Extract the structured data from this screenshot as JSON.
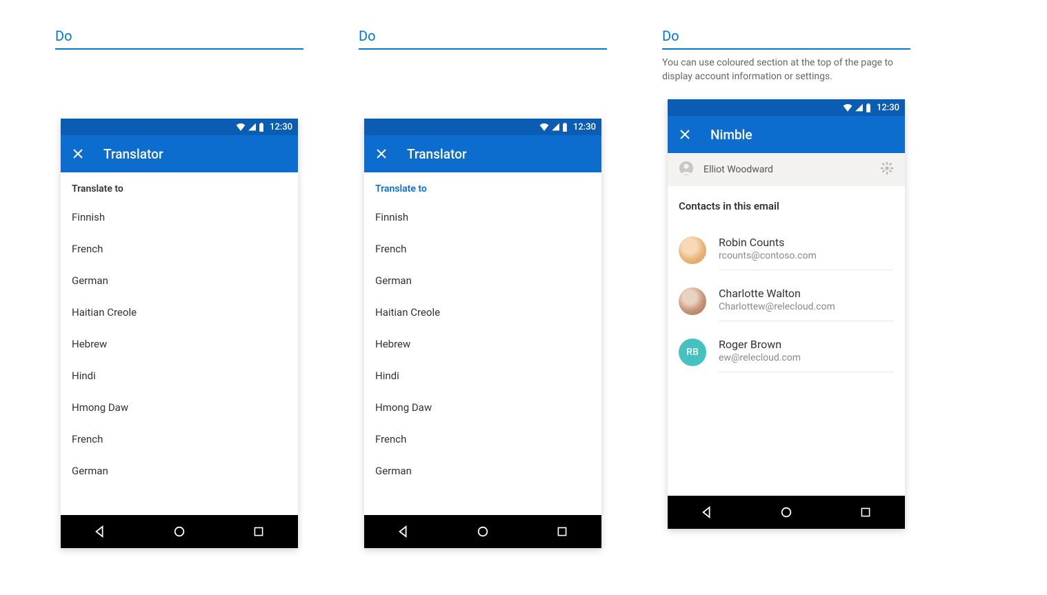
{
  "labels": {
    "do": "Do"
  },
  "captions": {
    "p1": "",
    "p2": "",
    "p3": "You can use coloured section at the top of the page to display account information or settings."
  },
  "status": {
    "time": "12:30"
  },
  "phone1": {
    "title": "Translator",
    "section": "Translate to",
    "items": [
      "Finnish",
      "French",
      "German",
      "Haitian Creole",
      "Hebrew",
      "Hindi",
      "Hmong Daw",
      "French",
      "German"
    ]
  },
  "phone2": {
    "title": "Translator",
    "section": "Translate to",
    "items": [
      "Finnish",
      "French",
      "German",
      "Haitian Creole",
      "Hebrew",
      "Hindi",
      "Hmong Daw",
      "French",
      "German"
    ]
  },
  "phone3": {
    "title": "Nimble",
    "account_name": "Elliot Woodward",
    "contacts_header": "Contacts in this email",
    "contacts": [
      {
        "name": "Robin Counts",
        "email": "rcounts@contoso.com",
        "initials": ""
      },
      {
        "name": "Charlotte Walton",
        "email": "Charlottew@relecloud.com",
        "initials": ""
      },
      {
        "name": "Roger Brown",
        "email": "ew@relecloud.com",
        "initials": "RB"
      }
    ]
  }
}
